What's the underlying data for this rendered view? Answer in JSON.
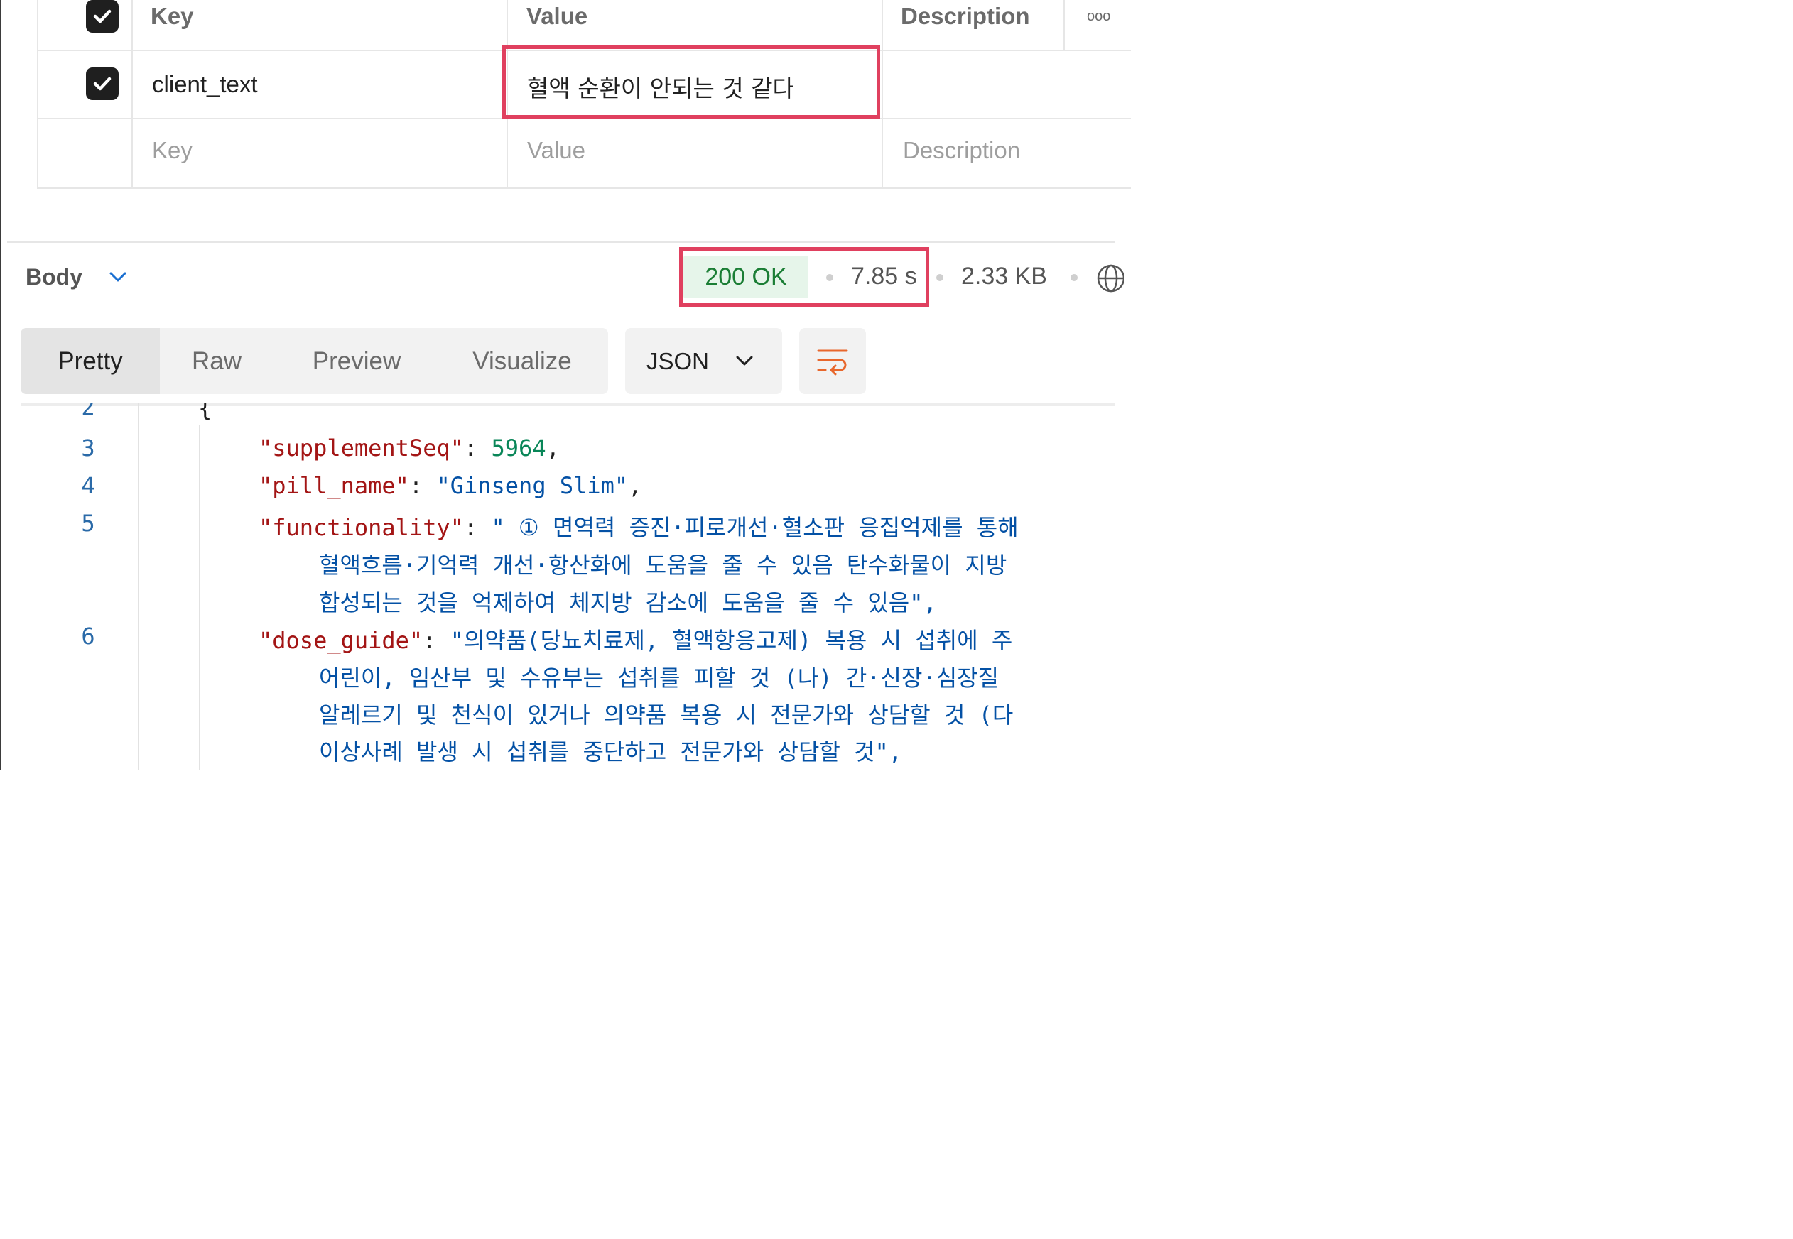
{
  "params": {
    "headers": {
      "key": "Key",
      "value": "Value",
      "description": "Description"
    },
    "more_label": "ooo",
    "rows": [
      {
        "checked": true,
        "key": "client_text",
        "value": "혈액 순환이 안되는 것 같다"
      }
    ],
    "placeholder": {
      "key": "Key",
      "value": "Value",
      "description": "Description"
    }
  },
  "response": {
    "section_label": "Body",
    "status": "200 OK",
    "time": "7.85 s",
    "size": "2.33 KB",
    "status_color": "#1b7e35"
  },
  "view_tabs": [
    "Pretty",
    "Raw",
    "Preview",
    "Visualize"
  ],
  "active_view_tab": "Pretty",
  "format": {
    "selected": "JSON"
  },
  "icons": [
    "checkbox-checked-icon",
    "chevron-down-icon",
    "globe-icon",
    "word-wrap-icon"
  ],
  "code": {
    "line_numbers": [
      "2",
      "3",
      "4",
      "5",
      "6"
    ],
    "line2_brace": "{",
    "supplementSeq": {
      "key": "\"supplementSeq\"",
      "value": "5964"
    },
    "pill_name": {
      "key": "\"pill_name\"",
      "value": "\"Ginseng Slim\""
    },
    "functionality": {
      "key": "\"functionality\"",
      "lines": [
        "\" ① 면역력 증진·피로개선·혈소판 응집억제를 통해",
        "혈액흐름·기억력 개선·항산화에 도움을 줄 수 있음 탄수화물이 지방",
        "합성되는 것을 억제하여 체지방 감소에 도움을 줄 수 있음\","
      ]
    },
    "dose_guide": {
      "key": "\"dose_guide\"",
      "lines": [
        "\"의약품(당뇨치료제, 혈액항응고제) 복용 시 섭취에 주",
        "어린이, 임산부 및 수유부는 섭취를 피할 것 (나) 간·신장·심장질",
        "알레르기 및 천식이 있거나 의약품 복용 시 전문가와 상담할 것 (다",
        "이상사례 발생 시 섭취를 중단하고 전문가와 상담할 것\","
      ]
    }
  }
}
